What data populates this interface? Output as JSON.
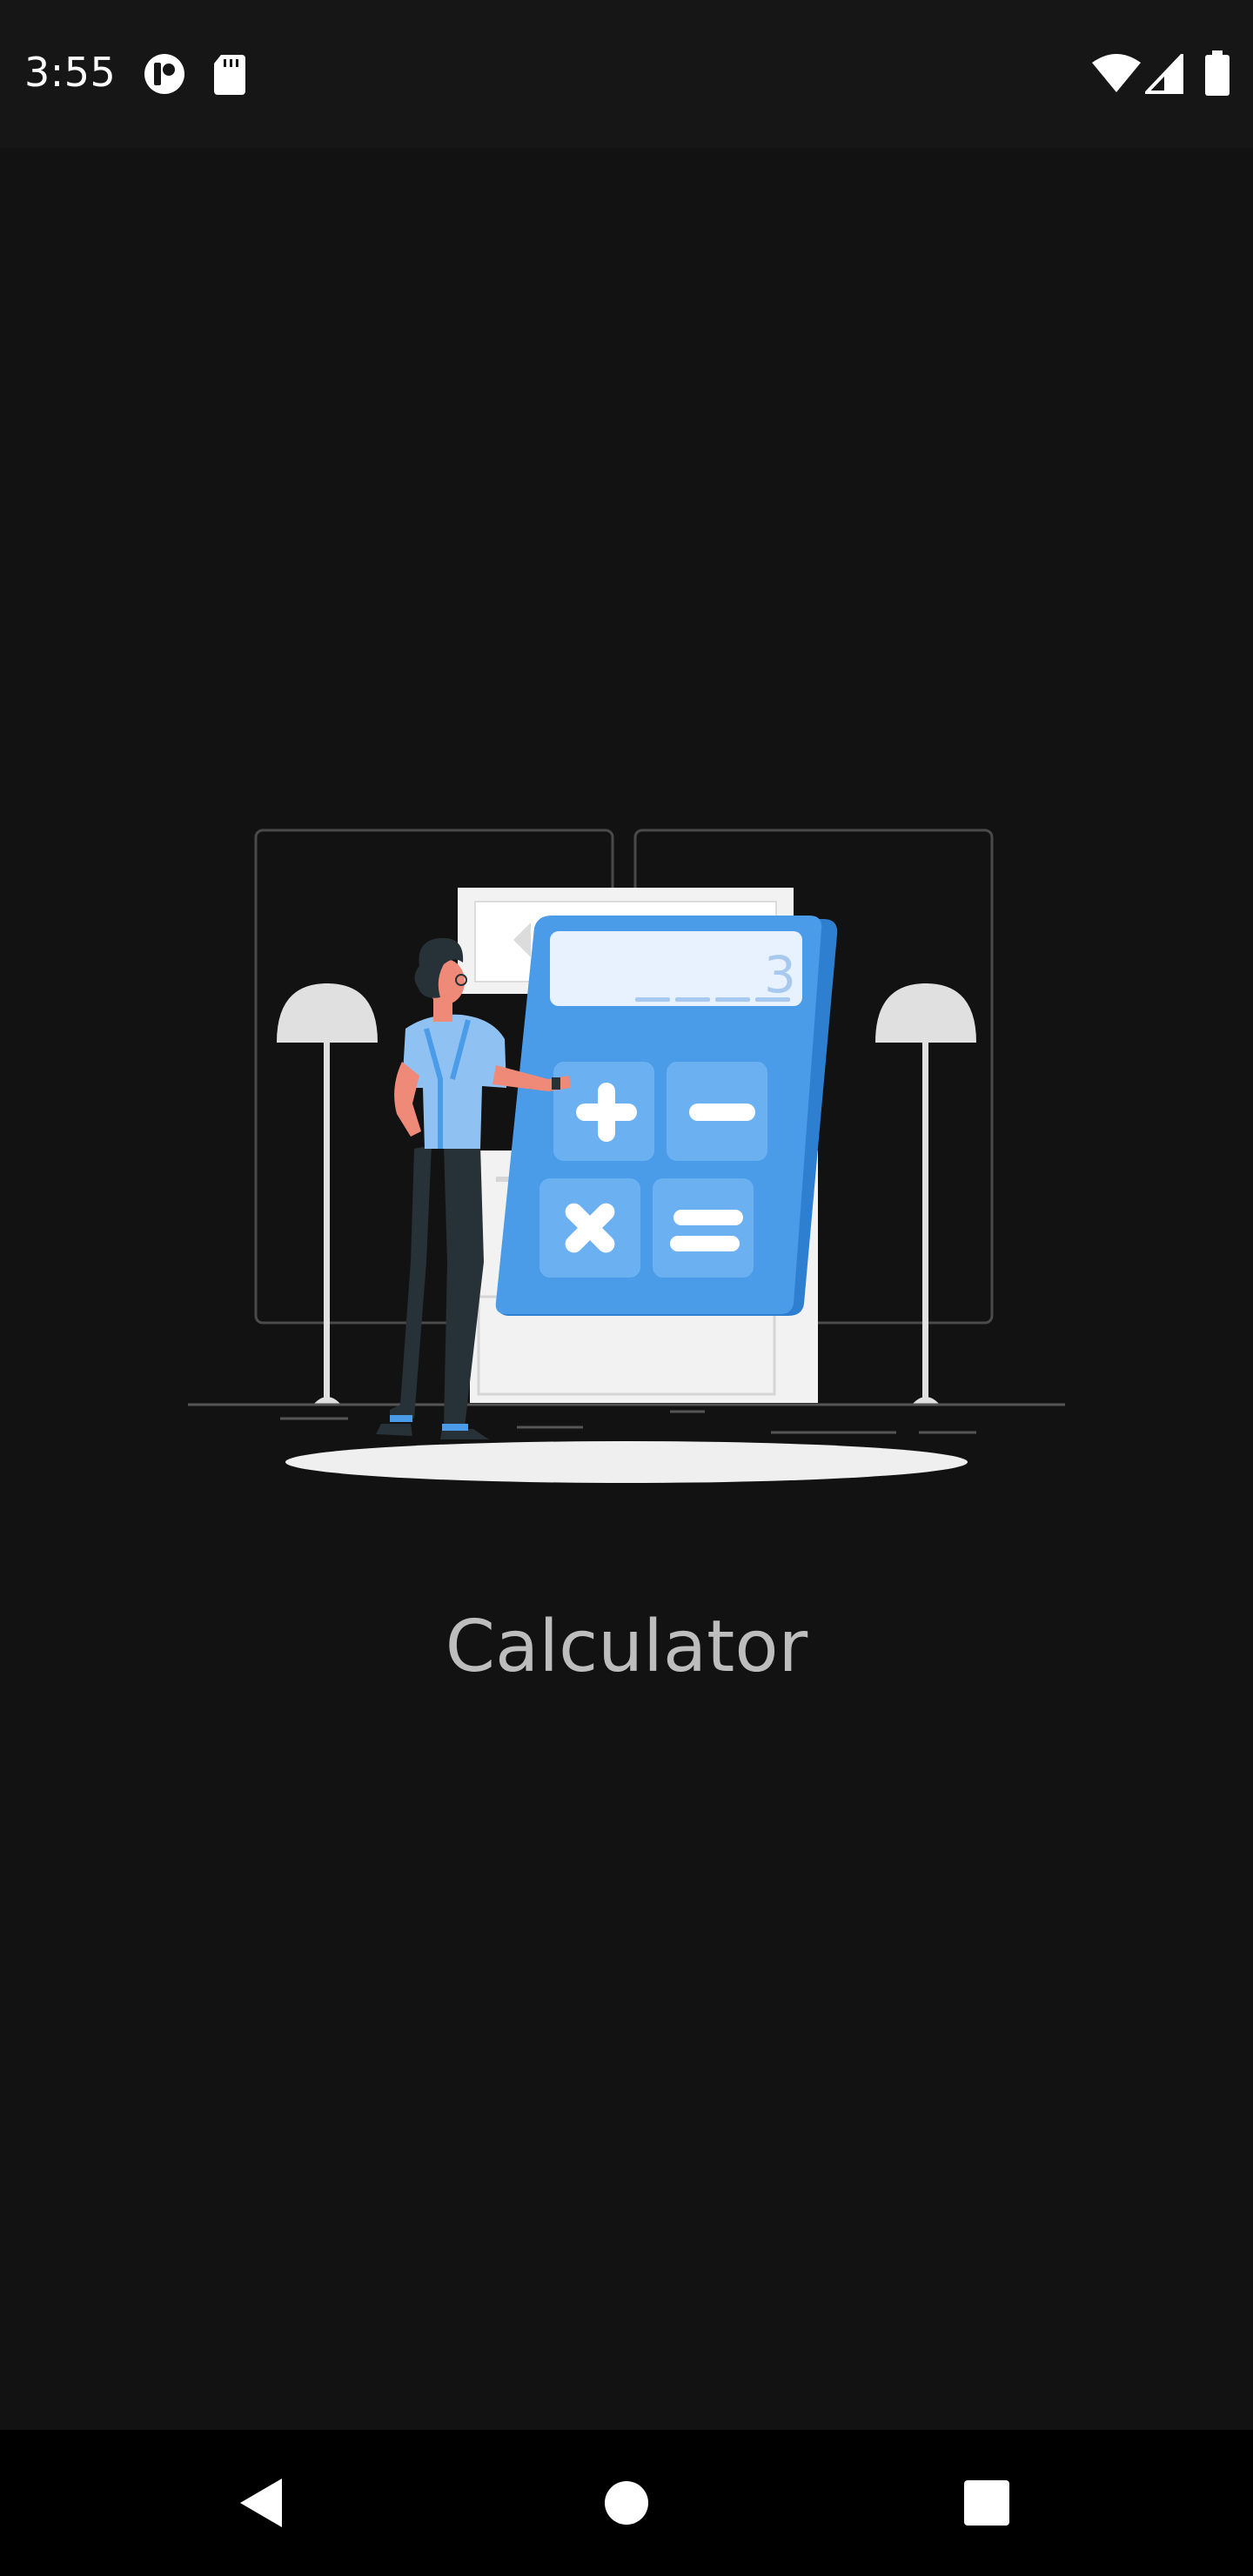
{
  "status_bar": {
    "time": "3:55",
    "left_icons": [
      "notification-app-icon",
      "sd-card-icon"
    ],
    "right_icons": [
      "wifi-icon",
      "cellular-signal-icon",
      "battery-icon"
    ]
  },
  "splash": {
    "illustration": "person-with-calculator-illustration",
    "calculator_display_digit": "3",
    "app_title": "Calculator"
  },
  "navigation_bar": {
    "buttons": [
      "back-icon",
      "home-icon",
      "recents-icon"
    ]
  },
  "colors": {
    "background": "#121212",
    "accent_blue": "#4a9be8",
    "title_text": "#bdbdbd"
  }
}
